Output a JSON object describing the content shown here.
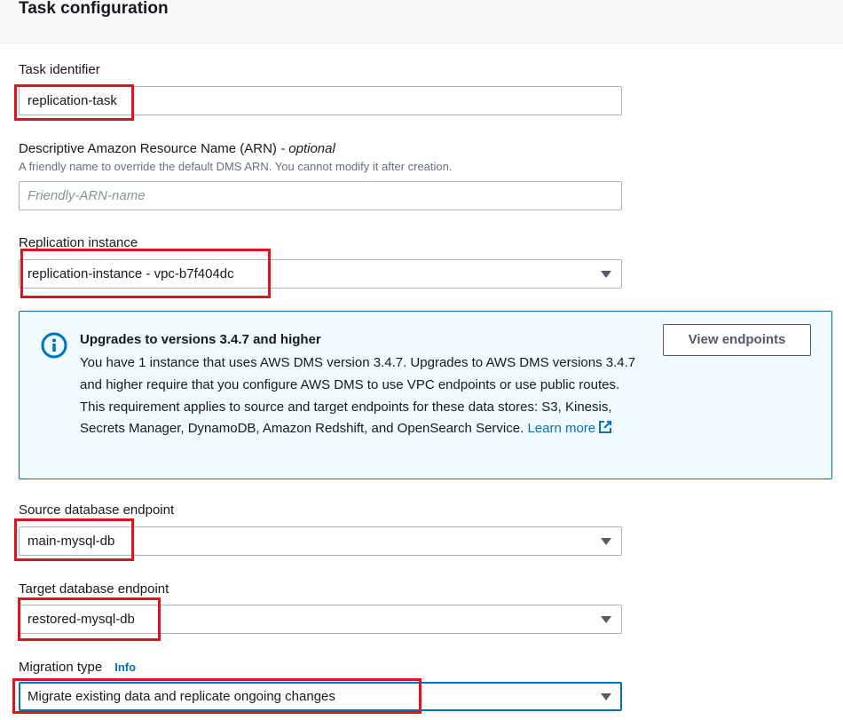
{
  "section": {
    "title": "Task configuration"
  },
  "task_identifier": {
    "label": "Task identifier",
    "value": "replication-task"
  },
  "arn": {
    "label": "Descriptive Amazon Resource Name (ARN)",
    "optional_text": " - optional",
    "description": "A friendly name to override the default DMS ARN. You cannot modify it after creation.",
    "placeholder": "Friendly-ARN-name"
  },
  "replication_instance": {
    "label": "Replication instance",
    "value": "replication-instance - vpc-b7f404dc"
  },
  "alert": {
    "icon": "info-icon",
    "title": "Upgrades to versions 3.4.7 and higher",
    "body": "You have 1 instance that uses AWS DMS version 3.4.7. Upgrades to AWS DMS versions 3.4.7 and higher require that you configure AWS DMS to use VPC endpoints or use public routes. This requirement applies to source and target endpoints for these data stores: S3, Kinesis, Secrets Manager, DynamoDB, Amazon Redshift, and OpenSearch Service.",
    "learn_more": "Learn more",
    "button": "View endpoints",
    "accent_color": "#0073bb"
  },
  "source_endpoint": {
    "label": "Source database endpoint",
    "value": "main-mysql-db"
  },
  "target_endpoint": {
    "label": "Target database endpoint",
    "value": "restored-mysql-db"
  },
  "migration_type": {
    "label": "Migration type",
    "info_link": "Info",
    "value": "Migrate existing data and replicate ongoing changes"
  },
  "highlight_color": "#e0121f"
}
